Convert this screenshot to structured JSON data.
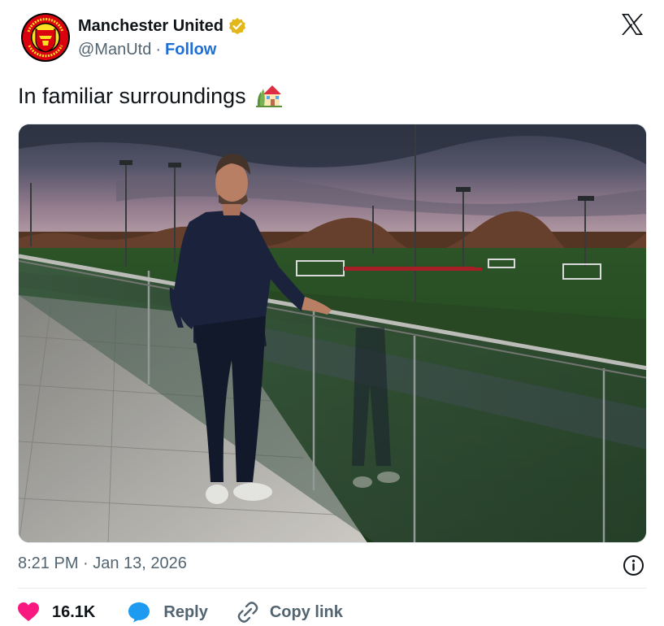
{
  "post": {
    "author_name": "Manchester United",
    "handle": "@ManUtd",
    "separator": "·",
    "follow_label": "Follow",
    "text": "In familiar surroundings",
    "timestamp": "8:21 PM · Jan 13, 2026"
  },
  "actions": {
    "likes_count": "16.1K",
    "reply_label": "Reply",
    "copy_link_label": "Copy link"
  },
  "icons": {
    "avatar": "manchester-united-crest",
    "verified": "gold-verified-badge",
    "platform": "x-logo",
    "emoji": "house-with-garden-emoji",
    "info": "info-circle-icon",
    "like": "heart-icon",
    "reply": "speech-bubble-icon",
    "copy": "link-icon"
  },
  "colors": {
    "text": "#0f1419",
    "secondary": "#536471",
    "follow": "#1d6fd6",
    "heart": "#f91880",
    "reply": "#1d9bf0",
    "verified": "#e2b719",
    "crest_red": "#da020e",
    "crest_gold": "#fbe122"
  }
}
